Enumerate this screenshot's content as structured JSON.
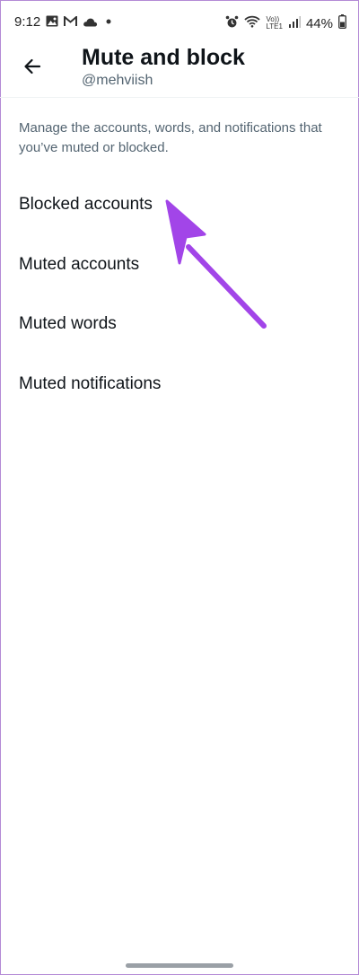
{
  "status_bar": {
    "time": "9:12",
    "battery": "44%",
    "network": "LTE1",
    "network_top": "Vo))",
    "left_icons": [
      "image-icon",
      "gmail-icon",
      "cloud-icon",
      "dot-icon"
    ],
    "right_icons": [
      "alarm-icon",
      "wifi-icon",
      "signal-icon",
      "battery-icon"
    ]
  },
  "header": {
    "title": "Mute and block",
    "subtitle": "@mehviish",
    "back_icon": "arrow-left-icon"
  },
  "main": {
    "description": "Manage the accounts, words, and notifications that you’ve muted or blocked.",
    "items": [
      {
        "label": "Blocked accounts"
      },
      {
        "label": "Muted accounts"
      },
      {
        "label": "Muted words"
      },
      {
        "label": "Muted notifications"
      }
    ]
  },
  "annotation": {
    "arrow_color": "#a245e8"
  }
}
